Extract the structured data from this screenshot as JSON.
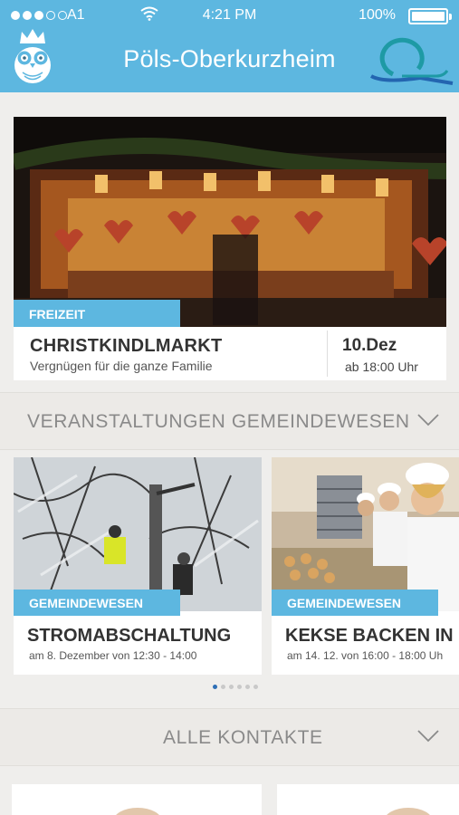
{
  "status_bar": {
    "carrier": "A1",
    "time": "4:21 PM",
    "battery": "100%"
  },
  "header": {
    "title": "Pöls-Oberkurzheim",
    "colors": {
      "primary": "#5db7e0",
      "logo_teal": "#1e9aa5",
      "logo_blue": "#2365b0"
    },
    "icons": [
      "owl-crown-logo",
      "brand-logo"
    ]
  },
  "featured": {
    "tag": "FREIZEIT",
    "title": "CHRISTKINDLMARKT",
    "subtitle": "Vergnügen für die ganze Familie",
    "date": "10.Dez",
    "time": "ab 18:00 Uhr"
  },
  "section_events": {
    "label": "VERANSTALTUNGEN GEMEINDEWESEN"
  },
  "cards": [
    {
      "tag": "GEMEINDEWESEN",
      "title": "STROMABSCHALTUNG",
      "subtitle": "am 8. Dezember von 12:30 - 14:00"
    },
    {
      "tag": "GEMEINDEWESEN",
      "title": "KEKSE BACKEN IN",
      "subtitle": "am 14. 12. von 16:00 - 18:00 Uh"
    }
  ],
  "pager": {
    "count": 6,
    "active": 1
  },
  "section_contacts": {
    "label": "ALLE KONTAKTE"
  }
}
